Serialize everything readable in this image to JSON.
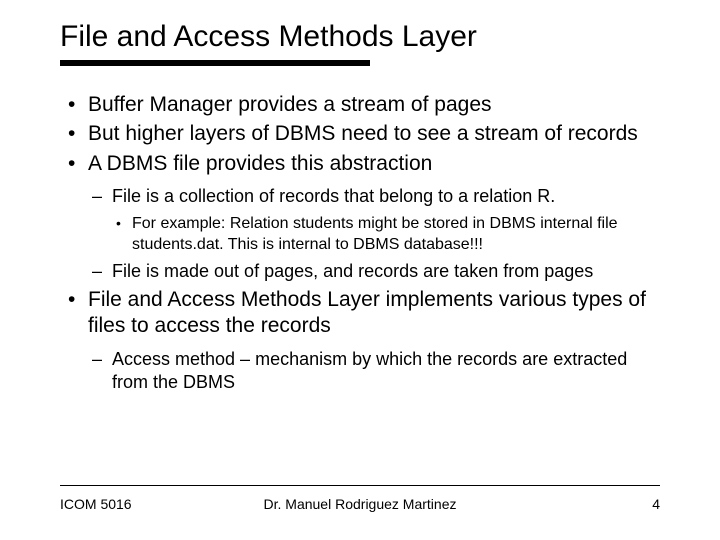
{
  "title": "File and Access Methods Layer",
  "bullets": {
    "b1": "Buffer Manager provides a stream of pages",
    "b2": "But higher layers of DBMS need to see a stream of records",
    "b3": "A DBMS file provides this abstraction",
    "b3_1": "File is a collection of records that belong to a relation R.",
    "b3_1_1": "For example: Relation students might be stored in DBMS internal file students.dat. This is internal to DBMS database!!!",
    "b3_2": "File is made out of pages, and records are taken from pages",
    "b4": "File and Access Methods Layer implements various types of files to access the records",
    "b4_1": "Access method – mechanism by which the records are extracted from the DBMS"
  },
  "footer": {
    "course": "ICOM 5016",
    "author": "Dr. Manuel Rodriguez Martinez",
    "page": "4"
  }
}
